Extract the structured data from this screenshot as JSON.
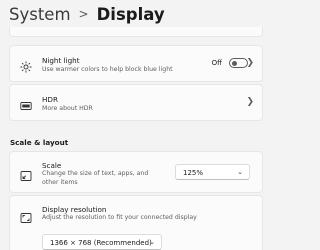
{
  "breadcrumb": {
    "parent": "System",
    "separator": ">",
    "current": "Display"
  },
  "night_light": {
    "title": "Night light",
    "subtitle": "Use warmer colors to help block blue light",
    "toggle_label": "Off",
    "toggle_on": false,
    "icon": "sun-brightness-icon"
  },
  "hdr": {
    "title": "HDR",
    "subtitle": "More about HDR",
    "icon": "hdr-icon"
  },
  "section_scale_layout": {
    "heading": "Scale & layout"
  },
  "scale": {
    "title": "Scale",
    "subtitle": "Change the size of text, apps, and other items",
    "value": "125%",
    "icon": "scale-resize-icon"
  },
  "resolution": {
    "title": "Display resolution",
    "subtitle": "Adjust the resolution to fit your connected display",
    "value": "1366 × 768 (Recommended)",
    "icon": "resolution-icon"
  },
  "colors": {
    "background": "#f3f3f3",
    "card": "#fbfbfb",
    "card_border": "#e6e6e6",
    "text_primary": "#1b1b1b",
    "text_secondary": "#5f5f5f"
  }
}
